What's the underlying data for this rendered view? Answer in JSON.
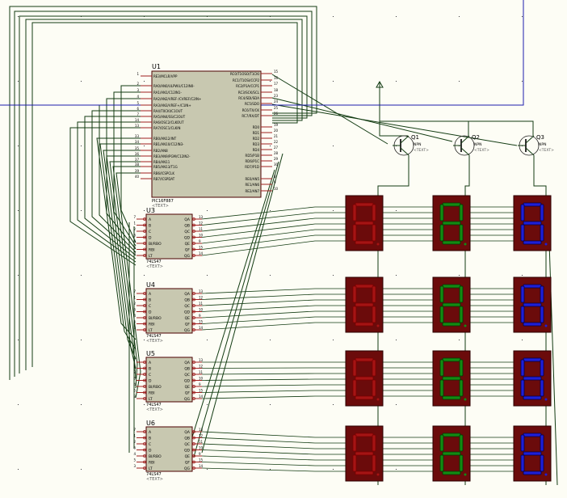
{
  "mcu": {
    "ref": "U1",
    "part": "PIC16F887",
    "text_tag": "<TEXT>",
    "left_pins": [
      {
        "num": "1",
        "name": "RE3/MCLR/VPP"
      },
      {
        "num": "2",
        "name": "RA0/AN0/ULPWU/C12IN0-"
      },
      {
        "num": "3",
        "name": "RA1/AN1/C12IN1-"
      },
      {
        "num": "4",
        "name": "RA2/AN2/VREF-/CVREF/C2IN+"
      },
      {
        "num": "5",
        "name": "RA3/AN3/VREF+/C1IN+"
      },
      {
        "num": "6",
        "name": "RA4/T0CKI/C1OUT"
      },
      {
        "num": "7",
        "name": "RA5/AN4/SS/C2OUT"
      },
      {
        "num": "14",
        "name": "RA6/OSC2/CLKOUT"
      },
      {
        "num": "13",
        "name": "RA7/OSC1/CLKIN"
      },
      {
        "num": "33",
        "name": "RB0/AN12/INT"
      },
      {
        "num": "34",
        "name": "RB1/AN10/C12IN3-"
      },
      {
        "num": "35",
        "name": "RB2/AN8"
      },
      {
        "num": "36",
        "name": "RB3/AN9/PGM/C12IN2-"
      },
      {
        "num": "37",
        "name": "RB4/AN11"
      },
      {
        "num": "38",
        "name": "RB5/AN13/T1G"
      },
      {
        "num": "39",
        "name": "RB6/ICSPCLK"
      },
      {
        "num": "40",
        "name": "RB7/ICSPDAT"
      }
    ],
    "right_pins": [
      {
        "num": "15",
        "name": "RC0/T1OSO/T1CKI"
      },
      {
        "num": "16",
        "name": "RC1/T1OSI/CCP2"
      },
      {
        "num": "17",
        "name": "RC2/P1A/CCP1"
      },
      {
        "num": "18",
        "name": "RC3/SCK/SCL"
      },
      {
        "num": "23",
        "name": "RC4/SDI/SDA"
      },
      {
        "num": "24",
        "name": "RC5/SDO"
      },
      {
        "num": "25",
        "name": "RC6/TX/CK"
      },
      {
        "num": "26",
        "name": "RC7/RX/DT"
      },
      {
        "num": "19",
        "name": "RD0"
      },
      {
        "num": "20",
        "name": "RD1"
      },
      {
        "num": "21",
        "name": "RD2"
      },
      {
        "num": "22",
        "name": "RD3"
      },
      {
        "num": "27",
        "name": "RD4"
      },
      {
        "num": "28",
        "name": "RD5/P1B"
      },
      {
        "num": "29",
        "name": "RD6/P1C"
      },
      {
        "num": "30",
        "name": "RD7/P1D"
      },
      {
        "num": "8",
        "name": "RE0/AN5"
      },
      {
        "num": "9",
        "name": "RE1/AN6"
      },
      {
        "num": "10",
        "name": "RE2/AN7"
      }
    ]
  },
  "decoders": [
    {
      "ref": "U3",
      "part": "74LS47",
      "text_tag": "<TEXT>"
    },
    {
      "ref": "U4",
      "part": "74LS47",
      "text_tag": "<TEXT>"
    },
    {
      "ref": "U5",
      "part": "74LS47",
      "text_tag": "<TEXT>"
    },
    {
      "ref": "U6",
      "part": "74LS47",
      "text_tag": "<TEXT>"
    }
  ],
  "decoder_pins": {
    "left": [
      {
        "num": "7",
        "name": "A"
      },
      {
        "num": "1",
        "name": "B"
      },
      {
        "num": "2",
        "name": "C"
      },
      {
        "num": "6",
        "name": "D"
      },
      {
        "num": "4",
        "name": "BI/RBO"
      },
      {
        "num": "5",
        "name": "RBI"
      },
      {
        "num": "3",
        "name": "LT"
      }
    ],
    "right": [
      {
        "num": "13",
        "name": "QA"
      },
      {
        "num": "12",
        "name": "QB"
      },
      {
        "num": "11",
        "name": "QC"
      },
      {
        "num": "10",
        "name": "QD"
      },
      {
        "num": "9",
        "name": "QE"
      },
      {
        "num": "15",
        "name": "QF"
      },
      {
        "num": "14",
        "name": "QG"
      }
    ]
  },
  "transistors": [
    {
      "ref": "Q1",
      "part": "NPN",
      "text_tag": "<TEXT>"
    },
    {
      "ref": "Q2",
      "part": "NPN",
      "text_tag": "<TEXT>"
    },
    {
      "ref": "Q3",
      "part": "NPN",
      "text_tag": "<TEXT>"
    }
  ],
  "displays": {
    "digit": "8",
    "columns": [
      {
        "color": "dim-red",
        "segment_color": "#a51414",
        "outline_color": "#7a0000"
      },
      {
        "color": "green",
        "segment_color": "#138a13",
        "outline_color": "#003800"
      },
      {
        "color": "blue",
        "segment_color": "#1f1fd6",
        "outline_color": "#00004a"
      }
    ],
    "rows": 4
  },
  "colors": {
    "background": "#fdfdf5",
    "wire": "#123b12",
    "component_body": "#c8c8b0",
    "component_outline": "#4a0000",
    "pin": "#a02020",
    "display_case": "#6b0b0b",
    "probe_line": "#1d1dad",
    "grid_dot": "#3a3a3a"
  }
}
